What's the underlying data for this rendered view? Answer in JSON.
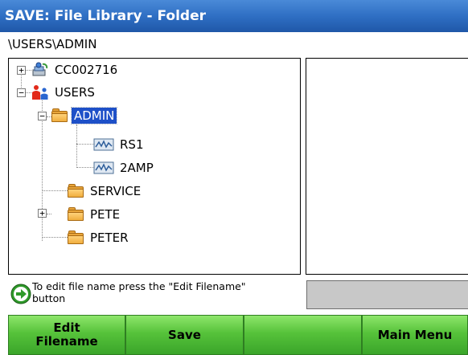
{
  "window": {
    "title": "SAVE: File Library - Folder"
  },
  "path": "\\USERS\\ADMIN",
  "tree": {
    "root_computer": "CC002716",
    "root_users": "USERS",
    "admin": "ADMIN",
    "rs1": "RS1",
    "amp2": "2AMP",
    "service": "SERVICE",
    "pete": "PETE",
    "peter": "PETER"
  },
  "status": {
    "message": "To edit file name press the \"Edit Filename\" button"
  },
  "buttons": {
    "edit_filename": "Edit\nFilename",
    "save": "Save",
    "blank": "",
    "main_menu": "Main Menu"
  },
  "colors": {
    "title_bar": "#2f6fc4",
    "selection": "#1e50c8",
    "button_green": "#56c23a",
    "folder": "#f0ae3e"
  }
}
